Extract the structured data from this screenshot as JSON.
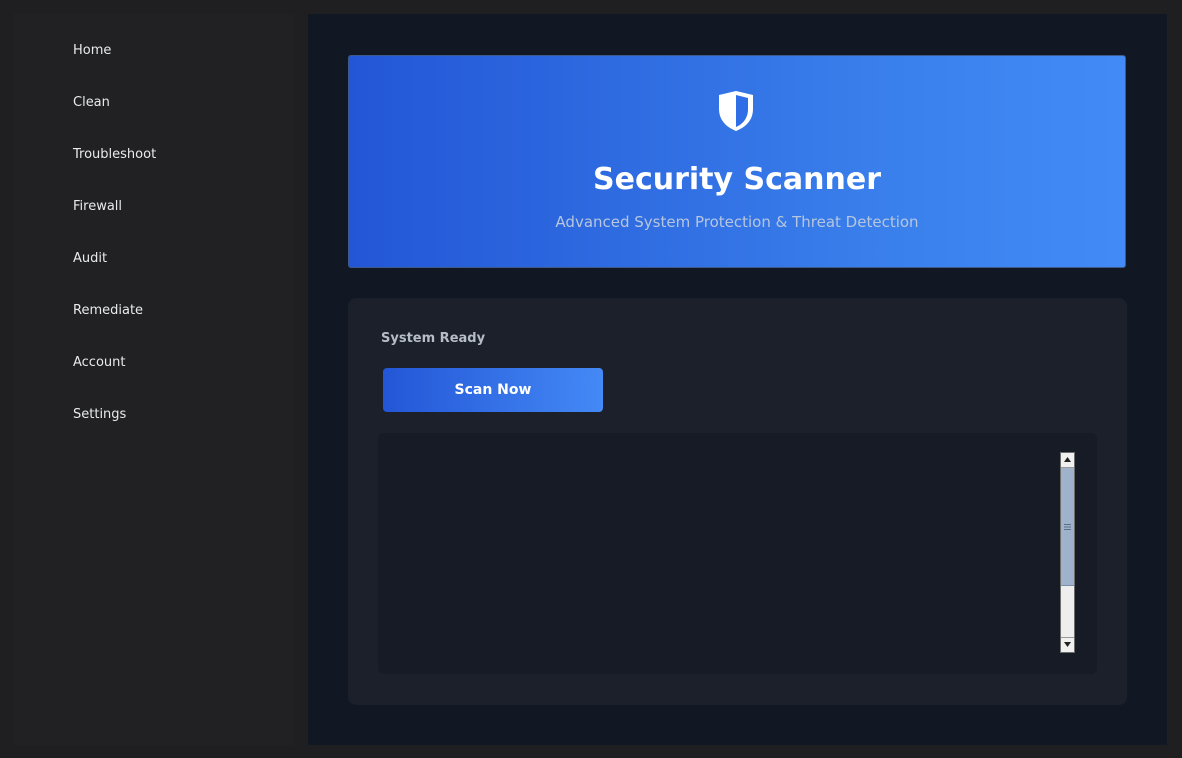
{
  "sidebar": {
    "items": [
      {
        "label": "Home"
      },
      {
        "label": "Clean"
      },
      {
        "label": "Troubleshoot"
      },
      {
        "label": "Firewall"
      },
      {
        "label": "Audit"
      },
      {
        "label": "Remediate"
      },
      {
        "label": "Account"
      },
      {
        "label": "Settings"
      }
    ]
  },
  "hero": {
    "icon": "shield-icon",
    "title": "Security Scanner",
    "subtitle": "Advanced System Protection & Threat Detection"
  },
  "panel": {
    "status": "System Ready",
    "scan_button_label": "Scan Now",
    "log": ""
  },
  "colors": {
    "accent_start": "#2356d6",
    "accent_end": "#428bf6",
    "background": "#121823",
    "sidebar": "#212124"
  }
}
